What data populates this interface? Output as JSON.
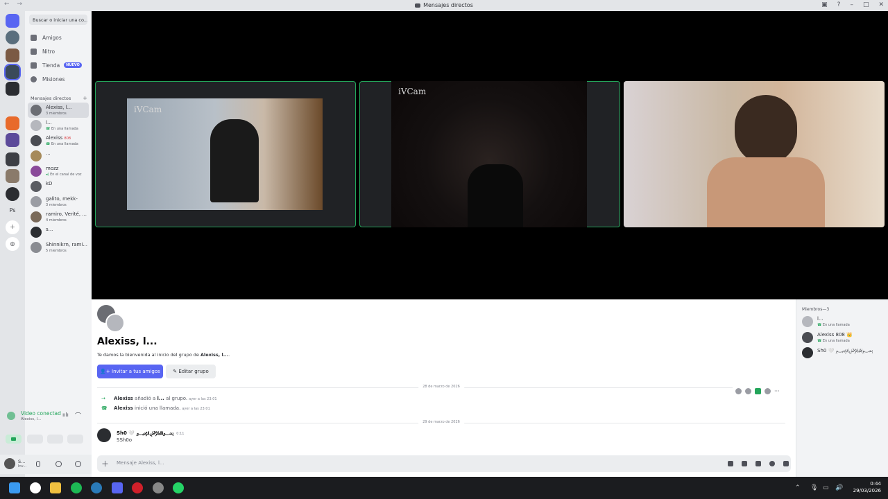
{
  "window": {
    "title": "Mensajes directos"
  },
  "sidebar": {
    "search_placeholder": "Buscar o iniciar una co...",
    "nav": [
      {
        "label": "Amigos",
        "icon": "friends-icon"
      },
      {
        "label": "Nitro",
        "icon": "nitro-icon"
      },
      {
        "label": "Tienda",
        "icon": "shop-icon",
        "badge": "NUEVO"
      },
      {
        "label": "Misiones",
        "icon": "quests-icon"
      }
    ],
    "dm_header": "Mensajes directos",
    "dm_add": "+",
    "dms": [
      {
        "name": "Alexiss, l...",
        "sub": "3 miembros",
        "selected": true
      },
      {
        "name": "l...",
        "sub": "En una llamada"
      },
      {
        "name": "Alexiss",
        "sub": "En una llamada",
        "tag": "808"
      },
      {
        "name": "...",
        "sub": ""
      },
      {
        "name": "mozz",
        "sub": "En el canal de voz"
      },
      {
        "name": "kD",
        "sub": ""
      },
      {
        "name": "galito, mekk-",
        "sub": "3 miembros"
      },
      {
        "name": "ramiro, Verité, ...",
        "sub": "4 miembros"
      },
      {
        "name": "s...",
        "sub": ""
      },
      {
        "name": "Shinnikrn, rami...",
        "sub": "5 miembros"
      }
    ]
  },
  "voice_panel": {
    "status": "Video conectad",
    "channel": "Alexiss, l..."
  },
  "user_bar": {
    "name": "S...",
    "status": "Inv..."
  },
  "video": {
    "watermark_1": "iVCam",
    "watermark_2": "iVCam"
  },
  "chat": {
    "group_title": "Alexiss, l...",
    "welcome_prefix": "Te damos la bienvenida al inicio del grupo de ",
    "welcome_name": "Alexiss, l...",
    "welcome_suffix": ".",
    "invite_label": "Invitar a tus amigos",
    "edit_label": "Editar grupo",
    "date1": "28 de marzo de 2026",
    "sys1": {
      "user": "Alexiss",
      "text_a": " añadió a ",
      "target": "l...",
      "text_b": " al grupo.",
      "time": "ayer a las 23:01"
    },
    "sys2": {
      "user": "Alexiss",
      "text_a": " inició una llamada.",
      "time": "ayer a las 23:01"
    },
    "date2": "29 de marzo de 2026",
    "msg": {
      "user": "Sh0 🤍 ﷽",
      "time": "0:11",
      "text": "SSh0o"
    },
    "composer_placeholder": "Mensaje Alexiss, l..."
  },
  "members": {
    "header": "Miembros—3",
    "list": [
      {
        "name": "l...",
        "sub": "En una llamada"
      },
      {
        "name": "Alexiss 808 👑",
        "sub": "En una llamada"
      },
      {
        "name": "Sh0 🤍 ﷽",
        "sub": ""
      }
    ]
  },
  "taskbar": {
    "time": "0:44",
    "date": "29/03/2026"
  },
  "colors": {
    "accent": "#5865f2",
    "online": "#23a55a",
    "video_bg": "#000000"
  }
}
